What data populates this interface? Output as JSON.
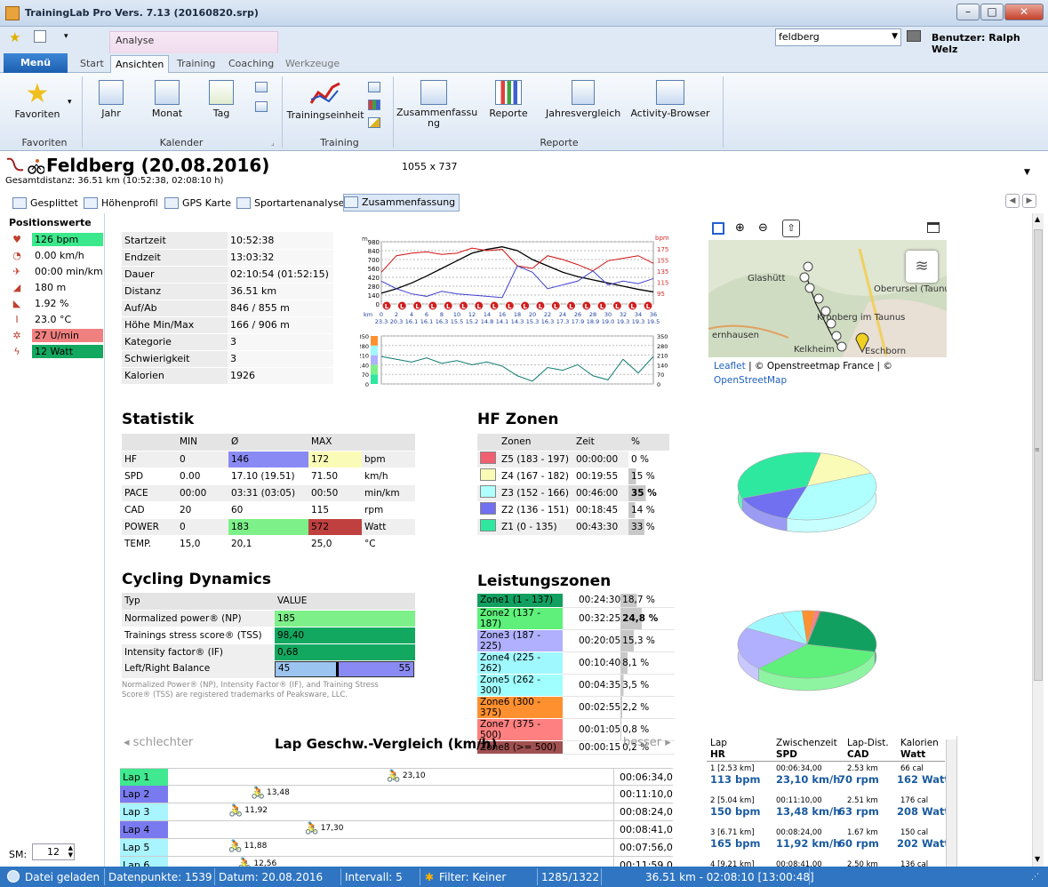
{
  "window": {
    "title": "TrainingLab Pro Vers. 7.13 (20160820.srp)"
  },
  "ribbon": {
    "context_tab": "Analyse",
    "tabs": [
      "Start",
      "Ansichten",
      "Training",
      "Coaching",
      "Werkzeuge"
    ],
    "menu_label": "Menü",
    "search_value": "feldberg",
    "user_label": "Benutzer: Ralph Welz",
    "groups": {
      "favoriten": {
        "label": "Favoriten",
        "button": "Favoriten"
      },
      "kalender": {
        "label": "Kalender",
        "buttons": [
          "Jahr",
          "Monat",
          "Tag"
        ]
      },
      "training": {
        "label": "Training",
        "button": "Trainingseinheit"
      },
      "reporte": {
        "label": "Reporte",
        "buttons": [
          "Zusammenfassu ng",
          "Reporte",
          "Jahresvergleich",
          "Activity-Browser"
        ]
      }
    }
  },
  "doc": {
    "title": "Feldberg (20.08.2016)",
    "subtitle": "Gesamtdistanz: 36.51 km (10:52:38, 02:08:10 h)",
    "size": "1055 x 737"
  },
  "subtabs": [
    "Gesplittet",
    "Höhenprofil",
    "GPS Karte",
    "Sportartenanalyse",
    "Zusammenfassung"
  ],
  "position": {
    "title": "Positionswerte",
    "rows": [
      {
        "icon": "heart-icon",
        "value": "126 bpm",
        "color": "#3ce88c"
      },
      {
        "icon": "speed-icon",
        "value": "0.00 km/h",
        "color": ""
      },
      {
        "icon": "runner-icon",
        "value": "00:00 min/km",
        "color": ""
      },
      {
        "icon": "elevation-icon",
        "value": "180 m",
        "color": ""
      },
      {
        "icon": "gradient-icon",
        "value": "1.92 %",
        "color": ""
      },
      {
        "icon": "thermometer-icon",
        "value": "23.0 °C",
        "color": ""
      },
      {
        "icon": "cadence-icon",
        "value": "27 U/min",
        "color": "#f08080"
      },
      {
        "icon": "power-icon",
        "value": "12 Watt",
        "color": "#13a860"
      }
    ],
    "sm_label": "SM:",
    "sm_value": "12"
  },
  "summary": [
    [
      "Startzeit",
      "10:52:38"
    ],
    [
      "Endzeit",
      "13:03:32"
    ],
    [
      "Dauer",
      "02:10:54 (01:52:15)"
    ],
    [
      "Distanz",
      "36.51 km"
    ],
    [
      "Auf/Ab",
      "846 / 855 m"
    ],
    [
      "Höhe Min/Max",
      "166 / 906 m"
    ],
    [
      "Kategorie",
      "3"
    ],
    [
      "Schwierigkeit",
      "3"
    ],
    [
      "Kalorien",
      "1926"
    ]
  ],
  "chart_data": [
    {
      "type": "line",
      "x": [
        0,
        2,
        4,
        6,
        8,
        10,
        12,
        14,
        16,
        18,
        20,
        22,
        24,
        26,
        28,
        30,
        32,
        34,
        36
      ],
      "xlabel": "km",
      "yleft_ticks": [
        0,
        140,
        280,
        420,
        560,
        700,
        840,
        980
      ],
      "yleft_unit": "m",
      "yright_ticks": [
        95,
        115,
        135,
        155,
        175
      ],
      "yright_unit": "bpm",
      "ylim": [
        0,
        980
      ],
      "series": [
        {
          "name": "Höhe",
          "color": "#000000",
          "values": [
            170,
            240,
            330,
            440,
            560,
            680,
            800,
            860,
            900,
            840,
            700,
            600,
            500,
            430,
            380,
            330,
            280,
            230,
            190
          ]
        },
        {
          "name": "Puls",
          "color": "#d01010",
          "values": [
            500,
            760,
            800,
            820,
            780,
            800,
            880,
            840,
            860,
            600,
            560,
            760,
            700,
            620,
            520,
            680,
            720,
            760,
            640
          ]
        },
        {
          "name": "Geschw.",
          "color": "#4040d0",
          "values": [
            360,
            240,
            160,
            120,
            200,
            160,
            140,
            120,
            100,
            600,
            500,
            240,
            300,
            360,
            520,
            300,
            360,
            320,
            400
          ]
        }
      ],
      "speed_labels": [
        "23.3",
        "20.3",
        "16.1",
        "16.1",
        "16.3",
        "15.5",
        "15.2",
        "14.8",
        "14.1",
        "14.3",
        "15.3",
        "16.3",
        "17.3",
        "17.9",
        "18.9",
        "19.0",
        "19.3",
        "19.3",
        "19.5"
      ]
    },
    {
      "type": "line",
      "x": [
        0,
        2,
        4,
        6,
        8,
        10,
        12,
        14,
        16,
        18,
        20,
        22,
        24,
        26,
        28,
        30,
        32,
        34,
        36
      ],
      "yticks": [
        0,
        70,
        140,
        210,
        280,
        350
      ],
      "ylim": [
        0,
        350
      ],
      "series": [
        {
          "name": "Watt",
          "color": "#0e7a72",
          "values": [
            200,
            180,
            160,
            190,
            150,
            170,
            140,
            160,
            130,
            60,
            20,
            120,
            100,
            140,
            60,
            30,
            180,
            80,
            200
          ]
        }
      ]
    },
    {
      "type": "pie",
      "title": "HF Zonen",
      "categories": [
        "Z5 (183 - 197)",
        "Z4 (167 - 182)",
        "Z3 (152 - 166)",
        "Z2 (136 - 151)",
        "Z1 (0 - 135)"
      ],
      "values": [
        0,
        15,
        35,
        14,
        33
      ],
      "colors": [
        "#f06070",
        "#fbfbb8",
        "#b0ffff",
        "#7070f0",
        "#2ee8a0"
      ]
    },
    {
      "type": "pie",
      "title": "Leistungszonen",
      "categories": [
        "Zone1 (1 - 137)",
        "Zone2 (137 - 187)",
        "Zone3 (187 - 225)",
        "Zone4 (225 - 262)",
        "Zone5 (262 - 300)",
        "Zone6 (300 - 375)",
        "Zone7 (375 - 500)",
        "Zone8 (>= 500)"
      ],
      "values": [
        18.7,
        24.8,
        15.3,
        8.1,
        3.5,
        2.2,
        0.8,
        0.2
      ],
      "colors": [
        "#12a060",
        "#5ef07a",
        "#b0b0ff",
        "#a0f8ff",
        "#a0ffff",
        "#ff9030",
        "#ff8080",
        "#a05050"
      ]
    }
  ],
  "statistik": {
    "title": "Statistik",
    "header": [
      "",
      "MIN",
      "Ø",
      "MAX",
      ""
    ],
    "rows": [
      [
        "HF",
        "0",
        "146",
        "172",
        "bpm"
      ],
      [
        "SPD",
        "0.00",
        "17.10 (19.51)",
        "71.50",
        "km/h"
      ],
      [
        "PACE",
        "00:00",
        "03:31 (03:05)",
        "00:50",
        "min/km"
      ],
      [
        "CAD",
        "20",
        "60",
        "115",
        "rpm"
      ],
      [
        "POWER",
        "0",
        "183",
        "572",
        "Watt"
      ],
      [
        "TEMP.",
        "15,0",
        "20,1",
        "25,0",
        "°C"
      ]
    ]
  },
  "hfzonen": {
    "title": "HF Zonen",
    "header": [
      "Zonen",
      "Zeit",
      "%"
    ],
    "rows": [
      [
        "Z5 (183 - 197)",
        "00:00:00",
        "0 %"
      ],
      [
        "Z4 (167 - 182)",
        "00:19:55",
        "15 %"
      ],
      [
        "Z3 (152 - 166)",
        "00:46:00",
        "35 %"
      ],
      [
        "Z2 (136 - 151)",
        "00:18:45",
        "14 %"
      ],
      [
        "Z1 (0 - 135)",
        "00:43:30",
        "33 %"
      ]
    ]
  },
  "cycling": {
    "title": "Cycling Dynamics",
    "header": [
      "Typ",
      "VALUE"
    ],
    "rows": [
      [
        "Normalized power® (NP)",
        "185"
      ],
      [
        "Trainings stress score® (TSS)",
        "98,40"
      ],
      [
        "Intensity factor® (IF)",
        "0,68"
      ]
    ],
    "balance_label": "Left/Right Balance",
    "balance_left": "45",
    "balance_right": "55",
    "footnote": "Normalized Power® (NP), Intensity Factor® (IF), and Training Stress Score® (TSS) are registered trademarks of Peaksware, LLC."
  },
  "leistung": {
    "title": "Leistungszonen",
    "rows": [
      [
        "Zone1 (1 - 137)",
        "00:24:30",
        "18,7 %"
      ],
      [
        "Zone2 (137 - 187)",
        "00:32:25",
        "24,8 %"
      ],
      [
        "Zone3 (187 - 225)",
        "00:20:05",
        "15,3 %"
      ],
      [
        "Zone4 (225 - 262)",
        "00:10:40",
        "8,1 %"
      ],
      [
        "Zone5 (262 - 300)",
        "00:04:35",
        "3,5 %"
      ],
      [
        "Zone6 (300 - 375)",
        "00:02:55",
        "2,2 %"
      ],
      [
        "Zone7 (375 - 500)",
        "00:01:05",
        "0,8 %"
      ],
      [
        "Zone8 (>= 500)",
        "00:00:15",
        "0,2 %"
      ]
    ]
  },
  "map": {
    "attribution_leaflet": "Leaflet",
    "attribution_rest": "| © Openstreetmap France | ©",
    "attribution_osm": "OpenStreetMap",
    "places": [
      "Glashütt",
      "Oberursel (Taunus)",
      "Kronberg im Taunus",
      "ernhausen",
      "Kelkheim",
      "Eschborn"
    ]
  },
  "laps": {
    "worse": "schlechter",
    "better": "besser",
    "title": "Lap Geschw.-Vergleich (km/h)",
    "rows": [
      {
        "name": "Lap 1",
        "speed": "23,10",
        "time": "00:06:34,00",
        "color": "#40e890"
      },
      {
        "name": "Lap 2",
        "speed": "13,48",
        "time": "00:11:10,00",
        "color": "#7a7af0"
      },
      {
        "name": "Lap 3",
        "speed": "11,92",
        "time": "00:08:24,00",
        "color": "#a8f4ff"
      },
      {
        "name": "Lap 4",
        "speed": "17,30",
        "time": "00:08:41,00",
        "color": "#7a7af0"
      },
      {
        "name": "Lap 5",
        "speed": "11,88",
        "time": "00:07:56,00",
        "color": "#a8f4ff"
      },
      {
        "name": "Lap 6",
        "speed": "12,56",
        "time": "00:11:59,00",
        "color": "#a8f4ff"
      }
    ]
  },
  "lapdetail": {
    "headers": [
      [
        "Lap",
        "HR"
      ],
      [
        "Zwischenzeit",
        "SPD"
      ],
      [
        "Lap-Dist.",
        "CAD"
      ],
      [
        "Kalorien",
        "Watt"
      ]
    ],
    "rows": [
      {
        "lap": "1 [2.53 km]",
        "zz": "00:06:34,00",
        "dist": "2.53 km",
        "cal": "66 cal",
        "hr": "113 bpm",
        "spd": "23,10 km/h",
        "cad": "70 rpm",
        "watt": "162 Watt"
      },
      {
        "lap": "2 [5.04 km]",
        "zz": "00:11:10,00",
        "dist": "2.51 km",
        "cal": "176 cal",
        "hr": "150 bpm",
        "spd": "13,48 km/h",
        "cad": "63 rpm",
        "watt": "208 Watt"
      },
      {
        "lap": "3 [6.71 km]",
        "zz": "00:08:24,00",
        "dist": "1.67 km",
        "cal": "150 cal",
        "hr": "165 bpm",
        "spd": "11,92 km/h",
        "cad": "60 rpm",
        "watt": "202 Watt"
      },
      {
        "lap": "4 [9.21 km]",
        "zz": "00:08:41,00",
        "dist": "2.50 km",
        "cal": "136 cal",
        "hr": "",
        "spd": "",
        "cad": "",
        "watt": ""
      }
    ]
  },
  "status": {
    "loaded": "Datei geladen",
    "points": "Datenpunkte: 1539",
    "date": "Datum: 20.08.2016",
    "interval": "Intervall: 5",
    "filter": "Filter: Keiner",
    "range": "1285/1322",
    "summary": "36.51 km - 02:08:10 [13:00:48]"
  }
}
